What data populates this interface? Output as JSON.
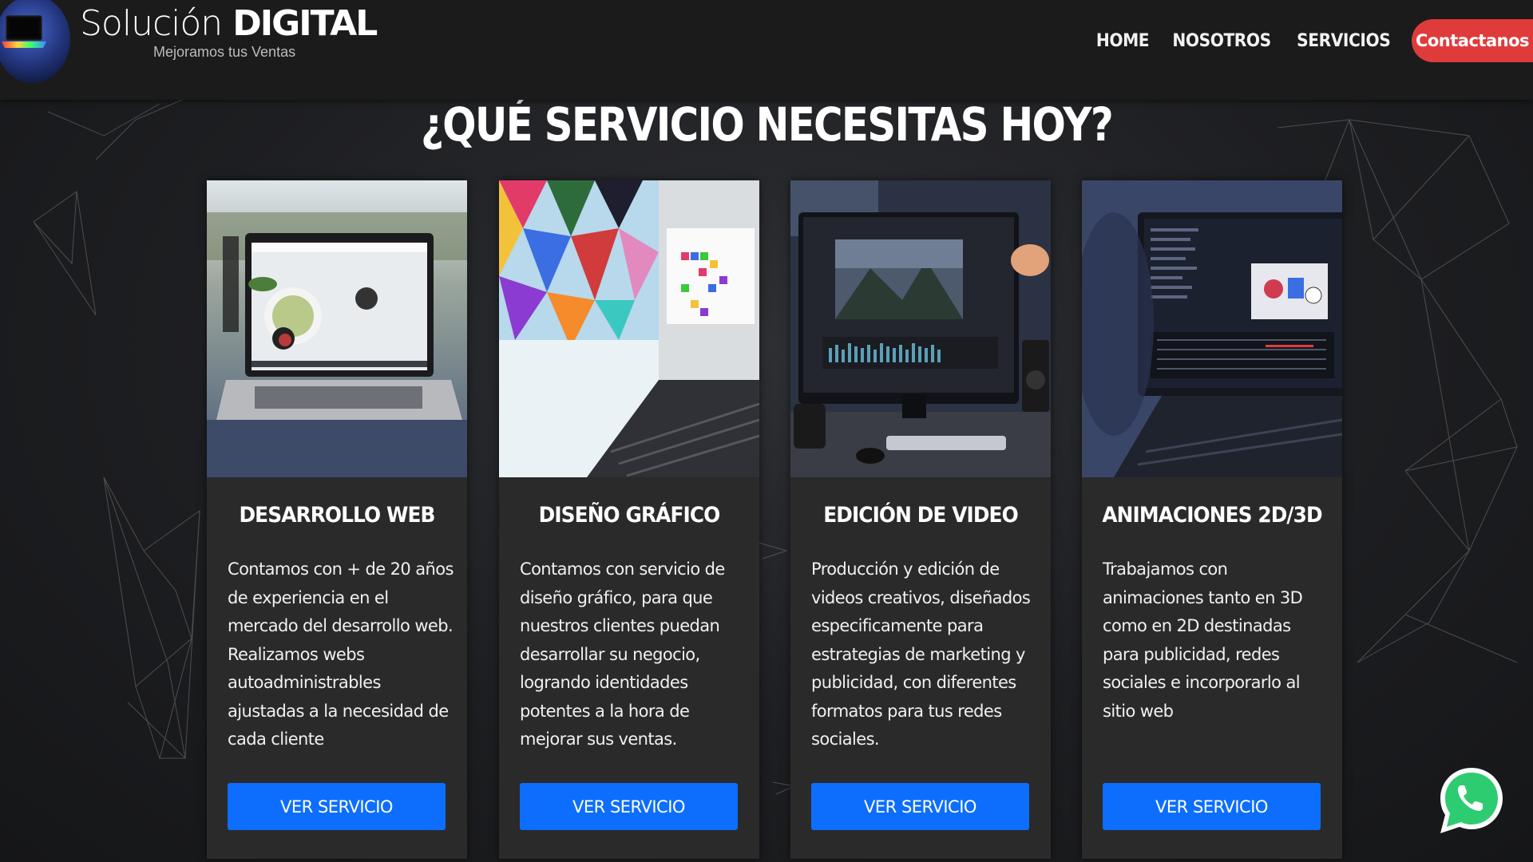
{
  "brand": {
    "name_light": "Solución",
    "name_bold": "DIGITAL",
    "tagline": "Mejoramos tus Ventas"
  },
  "nav": {
    "items": [
      {
        "label": "HOME"
      },
      {
        "label": "NOSOTROS"
      },
      {
        "label": "SERVICIOS"
      }
    ],
    "cta": "Contactanos"
  },
  "hero": {
    "title": "¿QUÉ SERVICIO NECESITAS HOY?"
  },
  "services": [
    {
      "title": "DESARROLLO WEB",
      "text": "Contamos con + de 20 años de experiencia en el mercado del desarrollo web. Realizamos webs autoadministrables ajustadas a la necesidad de cada cliente",
      "button": "VER SERVICIO"
    },
    {
      "title": "DISEÑO GRÁFICO",
      "text": "Contamos con servicio de diseño gráfico, para que nuestros clientes puedan desarrollar su negocio, logrando identidades potentes a la hora de mejorar sus ventas.",
      "button": "VER SERVICIO"
    },
    {
      "title": "EDICIÓN DE VIDEO",
      "text": "Producción y edición de videos creativos, diseñados especificamente para estrategias de marketing y publicidad, con diferentes formatos para tus redes sociales.",
      "button": "VER SERVICIO"
    },
    {
      "title": "ANIMACIONES 2D/3D",
      "text": "Trabajamos con animaciones tanto en 3D como en 2D destinadas para publicidad, redes sociales e incorporarlo al sitio web",
      "button": "VER SERVICIO"
    }
  ],
  "icons": {
    "logo": "laptop-logo-icon",
    "whatsapp": "whatsapp-icon"
  },
  "colors": {
    "cta": "#e03b3b",
    "button": "#0d6efd",
    "card_bg": "#2a2a2b",
    "header_bg": "#1b1b1b"
  }
}
